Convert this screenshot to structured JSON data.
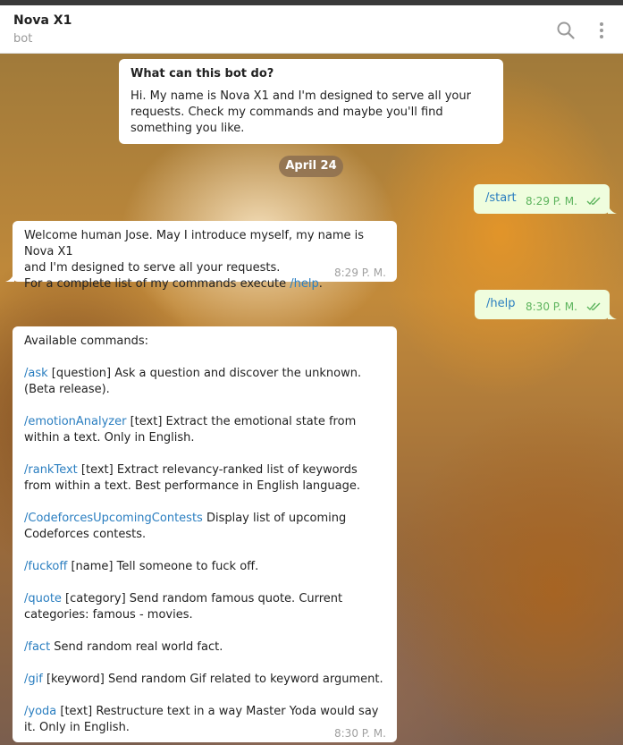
{
  "header": {
    "title": "Nova X1",
    "subtitle": "bot",
    "search_icon": "search-icon",
    "menu_icon": "more-vertical-icon"
  },
  "info_card": {
    "heading": "What can this bot do?",
    "body": "Hi. My name is Nova X1 and I'm designed to serve all your requests. Check my commands and maybe you'll find something you like."
  },
  "date_separator": "April 24",
  "messages": {
    "start": {
      "text": "/start",
      "time": "8:29 P. M."
    },
    "welcome": {
      "line1": "Welcome human Jose. May I introduce myself, my name is Nova X1",
      "line2": "and I'm designed to serve all your requests.",
      "line3_prefix": "For a complete list of my commands execute ",
      "line3_link": "/help",
      "line3_suffix": ".",
      "time": "8:29 P. M."
    },
    "help": {
      "text": "/help",
      "time": "8:30 P. M."
    },
    "commands": {
      "intro": "Available commands:",
      "items": [
        {
          "cmd": "/ask",
          "desc": " [question] Ask a question and discover the unknown. (Beta release)."
        },
        {
          "cmd": "/emotionAnalyzer",
          "desc": " [text] Extract the emotional state from within a text. Only in English."
        },
        {
          "cmd": "/rankText",
          "desc": " [text] Extract relevancy-ranked list of keywords from within a text. Best performance in English language."
        },
        {
          "cmd": "/CodeforcesUpcomingContests",
          "desc": " Display list of upcoming Codeforces contests."
        },
        {
          "cmd": "/fuckoff",
          "desc": " [name] Tell someone to fuck off."
        },
        {
          "cmd": "/quote",
          "desc": " [category] Send random famous quote. Current categories: famous - movies."
        },
        {
          "cmd": "/fact",
          "desc": " Send random real world fact."
        },
        {
          "cmd": "/gif",
          "desc": " [keyword] Send random Gif related to keyword argument."
        },
        {
          "cmd": "/yoda",
          "desc": " [text] Restructure text in a way Master Yoda would say it. Only in English."
        }
      ],
      "time": "8:30 P. M."
    }
  },
  "colors": {
    "link": "#2a7ec0",
    "outgoing_bubble": "#effdde",
    "outgoing_time": "#5db45d",
    "date_pill": "#8c6e50"
  }
}
